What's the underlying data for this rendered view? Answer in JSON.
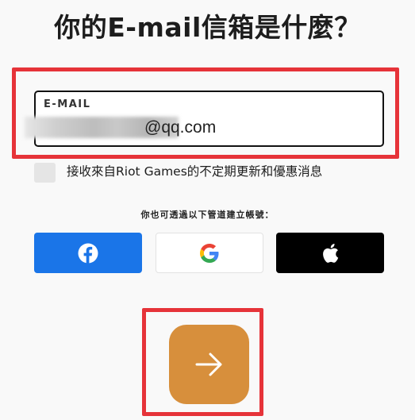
{
  "title": "你的E-mail信箱是什麼？",
  "email": {
    "label": "E-MAIL",
    "value_visible_suffix": "@qq.com"
  },
  "consent": {
    "label": "接收來自Riot Games的不定期更新和優惠消息"
  },
  "alternative_signup": {
    "text": "你也可透過以下管道建立帳號："
  },
  "social_buttons": [
    {
      "icon": "facebook-icon",
      "color": "#1a75e8"
    },
    {
      "icon": "google-icon",
      "color": "#ffffff"
    },
    {
      "icon": "apple-icon",
      "color": "#000000"
    }
  ],
  "next_button": {
    "icon": "arrow-right-icon",
    "color": "#d78f3c"
  },
  "highlight_color": "#e63339"
}
